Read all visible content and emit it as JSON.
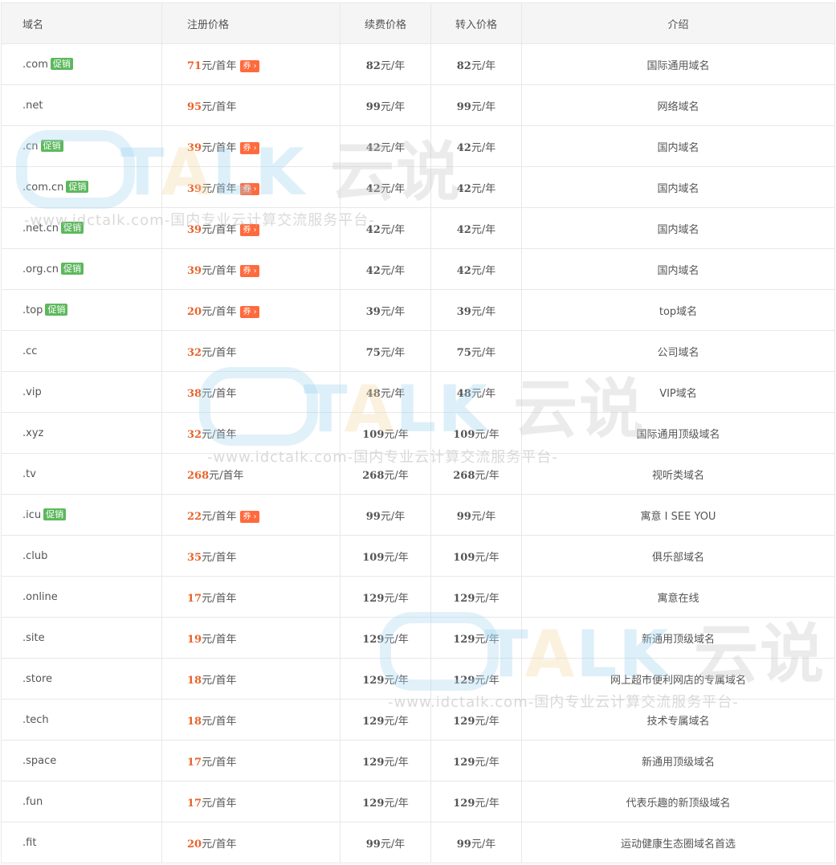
{
  "headers": [
    "域名",
    "注册价格",
    "续费价格",
    "转入价格",
    "介绍"
  ],
  "promo_label": "促销",
  "coupon_label": "券 ›",
  "rows": [
    {
      "domain": ".com",
      "promo": true,
      "reg": "71",
      "reg_unit": "元/首年",
      "coupon": true,
      "renew": "82",
      "transfer": "82",
      "unit": "元/年",
      "intro": "国际通用域名"
    },
    {
      "domain": ".net",
      "promo": false,
      "reg": "95",
      "reg_unit": "元/首年",
      "coupon": false,
      "renew": "99",
      "transfer": "99",
      "unit": "元/年",
      "intro": "网络域名"
    },
    {
      "domain": ".cn",
      "promo": true,
      "reg": "39",
      "reg_unit": "元/首年",
      "coupon": true,
      "renew": "42",
      "transfer": "42",
      "unit": "元/年",
      "intro": "国内域名"
    },
    {
      "domain": ".com.cn",
      "promo": true,
      "reg": "39",
      "reg_unit": "元/首年",
      "coupon": true,
      "renew": "42",
      "transfer": "42",
      "unit": "元/年",
      "intro": "国内域名"
    },
    {
      "domain": ".net.cn",
      "promo": true,
      "reg": "39",
      "reg_unit": "元/首年",
      "coupon": true,
      "renew": "42",
      "transfer": "42",
      "unit": "元/年",
      "intro": "国内域名"
    },
    {
      "domain": ".org.cn",
      "promo": true,
      "reg": "39",
      "reg_unit": "元/首年",
      "coupon": true,
      "renew": "42",
      "transfer": "42",
      "unit": "元/年",
      "intro": "国内域名"
    },
    {
      "domain": ".top",
      "promo": true,
      "reg": "20",
      "reg_unit": "元/首年",
      "coupon": true,
      "renew": "39",
      "transfer": "39",
      "unit": "元/年",
      "intro": "top域名"
    },
    {
      "domain": ".cc",
      "promo": false,
      "reg": "32",
      "reg_unit": "元/首年",
      "coupon": false,
      "renew": "75",
      "transfer": "75",
      "unit": "元/年",
      "intro": "公司域名"
    },
    {
      "domain": ".vip",
      "promo": false,
      "reg": "38",
      "reg_unit": "元/首年",
      "coupon": false,
      "renew": "48",
      "transfer": "48",
      "unit": "元/年",
      "intro": "VIP域名"
    },
    {
      "domain": ".xyz",
      "promo": false,
      "reg": "32",
      "reg_unit": "元/首年",
      "coupon": false,
      "renew": "109",
      "transfer": "109",
      "unit": "元/年",
      "intro": "国际通用顶级域名"
    },
    {
      "domain": ".tv",
      "promo": false,
      "reg": "268",
      "reg_unit": "元/首年",
      "coupon": false,
      "renew": "268",
      "transfer": "268",
      "unit": "元/年",
      "intro": "视听类域名"
    },
    {
      "domain": ".icu",
      "promo": true,
      "reg": "22",
      "reg_unit": "元/首年",
      "coupon": true,
      "renew": "99",
      "transfer": "99",
      "unit": "元/年",
      "intro": "寓意 I SEE YOU"
    },
    {
      "domain": ".club",
      "promo": false,
      "reg": "35",
      "reg_unit": "元/首年",
      "coupon": false,
      "renew": "109",
      "transfer": "109",
      "unit": "元/年",
      "intro": "俱乐部域名"
    },
    {
      "domain": ".online",
      "promo": false,
      "reg": "17",
      "reg_unit": "元/首年",
      "coupon": false,
      "renew": "129",
      "transfer": "129",
      "unit": "元/年",
      "intro": "寓意在线"
    },
    {
      "domain": ".site",
      "promo": false,
      "reg": "19",
      "reg_unit": "元/首年",
      "coupon": false,
      "renew": "129",
      "transfer": "129",
      "unit": "元/年",
      "intro": "新通用顶级域名"
    },
    {
      "domain": ".store",
      "promo": false,
      "reg": "18",
      "reg_unit": "元/首年",
      "coupon": false,
      "renew": "129",
      "transfer": "129",
      "unit": "元/年",
      "intro": "网上超市便利网店的专属域名"
    },
    {
      "domain": ".tech",
      "promo": false,
      "reg": "18",
      "reg_unit": "元/首年",
      "coupon": false,
      "renew": "129",
      "transfer": "129",
      "unit": "元/年",
      "intro": "技术专属域名"
    },
    {
      "domain": ".space",
      "promo": false,
      "reg": "17",
      "reg_unit": "元/首年",
      "coupon": false,
      "renew": "129",
      "transfer": "129",
      "unit": "元/年",
      "intro": "新通用顶级域名"
    },
    {
      "domain": ".fun",
      "promo": false,
      "reg": "17",
      "reg_unit": "元/首年",
      "coupon": false,
      "renew": "129",
      "transfer": "129",
      "unit": "元/年",
      "intro": "代表乐趣的新顶级域名"
    },
    {
      "domain": ".fit",
      "promo": false,
      "reg": "20",
      "reg_unit": "元/首年",
      "coupon": false,
      "renew": "99",
      "transfer": "99",
      "unit": "元/年",
      "intro": "运动健康生态圈域名首选"
    }
  ],
  "watermark": {
    "brand_t": "T",
    "brand_a": "A",
    "brand_lk": "LK",
    "brand_cn": "云说",
    "tagline": "-www.idctalk.com-国内专业云计算交流服务平台-"
  }
}
